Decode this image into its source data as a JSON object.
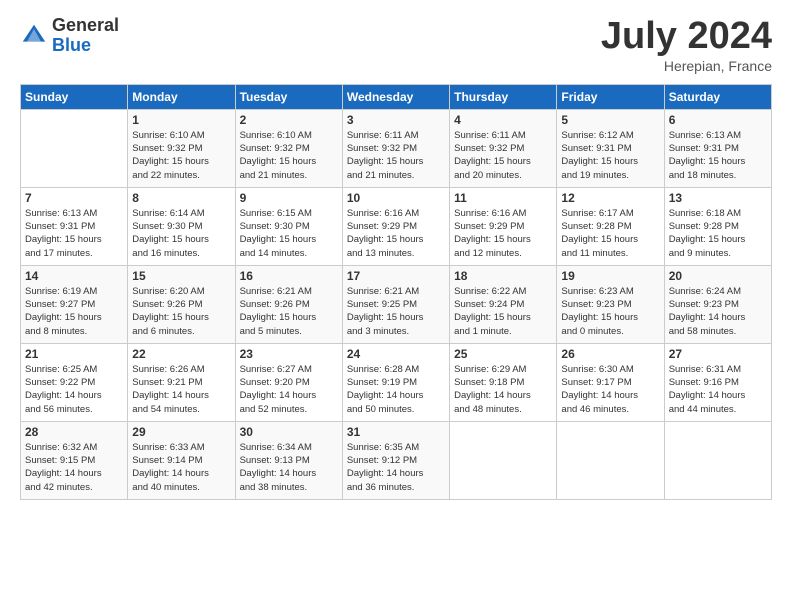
{
  "logo": {
    "general": "General",
    "blue": "Blue"
  },
  "title": "July 2024",
  "location": "Herepian, France",
  "days_of_week": [
    "Sunday",
    "Monday",
    "Tuesday",
    "Wednesday",
    "Thursday",
    "Friday",
    "Saturday"
  ],
  "weeks": [
    [
      {
        "day": "",
        "info": ""
      },
      {
        "day": "1",
        "info": "Sunrise: 6:10 AM\nSunset: 9:32 PM\nDaylight: 15 hours\nand 22 minutes."
      },
      {
        "day": "2",
        "info": "Sunrise: 6:10 AM\nSunset: 9:32 PM\nDaylight: 15 hours\nand 21 minutes."
      },
      {
        "day": "3",
        "info": "Sunrise: 6:11 AM\nSunset: 9:32 PM\nDaylight: 15 hours\nand 21 minutes."
      },
      {
        "day": "4",
        "info": "Sunrise: 6:11 AM\nSunset: 9:32 PM\nDaylight: 15 hours\nand 20 minutes."
      },
      {
        "day": "5",
        "info": "Sunrise: 6:12 AM\nSunset: 9:31 PM\nDaylight: 15 hours\nand 19 minutes."
      },
      {
        "day": "6",
        "info": "Sunrise: 6:13 AM\nSunset: 9:31 PM\nDaylight: 15 hours\nand 18 minutes."
      }
    ],
    [
      {
        "day": "7",
        "info": "Sunrise: 6:13 AM\nSunset: 9:31 PM\nDaylight: 15 hours\nand 17 minutes."
      },
      {
        "day": "8",
        "info": "Sunrise: 6:14 AM\nSunset: 9:30 PM\nDaylight: 15 hours\nand 16 minutes."
      },
      {
        "day": "9",
        "info": "Sunrise: 6:15 AM\nSunset: 9:30 PM\nDaylight: 15 hours\nand 14 minutes."
      },
      {
        "day": "10",
        "info": "Sunrise: 6:16 AM\nSunset: 9:29 PM\nDaylight: 15 hours\nand 13 minutes."
      },
      {
        "day": "11",
        "info": "Sunrise: 6:16 AM\nSunset: 9:29 PM\nDaylight: 15 hours\nand 12 minutes."
      },
      {
        "day": "12",
        "info": "Sunrise: 6:17 AM\nSunset: 9:28 PM\nDaylight: 15 hours\nand 11 minutes."
      },
      {
        "day": "13",
        "info": "Sunrise: 6:18 AM\nSunset: 9:28 PM\nDaylight: 15 hours\nand 9 minutes."
      }
    ],
    [
      {
        "day": "14",
        "info": "Sunrise: 6:19 AM\nSunset: 9:27 PM\nDaylight: 15 hours\nand 8 minutes."
      },
      {
        "day": "15",
        "info": "Sunrise: 6:20 AM\nSunset: 9:26 PM\nDaylight: 15 hours\nand 6 minutes."
      },
      {
        "day": "16",
        "info": "Sunrise: 6:21 AM\nSunset: 9:26 PM\nDaylight: 15 hours\nand 5 minutes."
      },
      {
        "day": "17",
        "info": "Sunrise: 6:21 AM\nSunset: 9:25 PM\nDaylight: 15 hours\nand 3 minutes."
      },
      {
        "day": "18",
        "info": "Sunrise: 6:22 AM\nSunset: 9:24 PM\nDaylight: 15 hours\nand 1 minute."
      },
      {
        "day": "19",
        "info": "Sunrise: 6:23 AM\nSunset: 9:23 PM\nDaylight: 15 hours\nand 0 minutes."
      },
      {
        "day": "20",
        "info": "Sunrise: 6:24 AM\nSunset: 9:23 PM\nDaylight: 14 hours\nand 58 minutes."
      }
    ],
    [
      {
        "day": "21",
        "info": "Sunrise: 6:25 AM\nSunset: 9:22 PM\nDaylight: 14 hours\nand 56 minutes."
      },
      {
        "day": "22",
        "info": "Sunrise: 6:26 AM\nSunset: 9:21 PM\nDaylight: 14 hours\nand 54 minutes."
      },
      {
        "day": "23",
        "info": "Sunrise: 6:27 AM\nSunset: 9:20 PM\nDaylight: 14 hours\nand 52 minutes."
      },
      {
        "day": "24",
        "info": "Sunrise: 6:28 AM\nSunset: 9:19 PM\nDaylight: 14 hours\nand 50 minutes."
      },
      {
        "day": "25",
        "info": "Sunrise: 6:29 AM\nSunset: 9:18 PM\nDaylight: 14 hours\nand 48 minutes."
      },
      {
        "day": "26",
        "info": "Sunrise: 6:30 AM\nSunset: 9:17 PM\nDaylight: 14 hours\nand 46 minutes."
      },
      {
        "day": "27",
        "info": "Sunrise: 6:31 AM\nSunset: 9:16 PM\nDaylight: 14 hours\nand 44 minutes."
      }
    ],
    [
      {
        "day": "28",
        "info": "Sunrise: 6:32 AM\nSunset: 9:15 PM\nDaylight: 14 hours\nand 42 minutes."
      },
      {
        "day": "29",
        "info": "Sunrise: 6:33 AM\nSunset: 9:14 PM\nDaylight: 14 hours\nand 40 minutes."
      },
      {
        "day": "30",
        "info": "Sunrise: 6:34 AM\nSunset: 9:13 PM\nDaylight: 14 hours\nand 38 minutes."
      },
      {
        "day": "31",
        "info": "Sunrise: 6:35 AM\nSunset: 9:12 PM\nDaylight: 14 hours\nand 36 minutes."
      },
      {
        "day": "",
        "info": ""
      },
      {
        "day": "",
        "info": ""
      },
      {
        "day": "",
        "info": ""
      }
    ]
  ]
}
